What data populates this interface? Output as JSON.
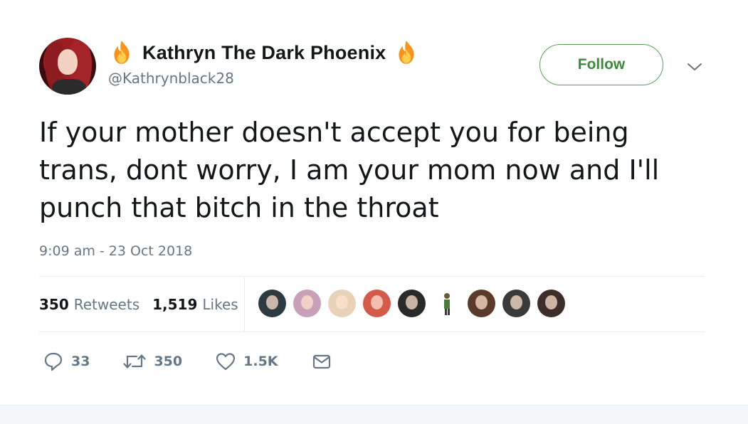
{
  "author": {
    "display_name": "Kathryn The Dark Phoenix",
    "handle": "@Kathrynblack28",
    "avatar_icon": "profile-avatar",
    "name_emoji_icon": "fire-emoji-icon"
  },
  "follow_label": "Follow",
  "tweet": {
    "text": "If your mother doesn't accept you for being\ntrans, dont worry, I am your mom now and I'll\npunch that bitch in the throat",
    "timestamp": "9:09 am - 23 Oct 2018"
  },
  "stats": {
    "retweets_count": "350",
    "retweets_label": "Retweets",
    "likes_count": "1,519",
    "likes_label": "Likes"
  },
  "likers_count_shown": 9,
  "actions": {
    "reply_count": "33",
    "retweet_count": "350",
    "like_count": "1.5K"
  },
  "colors": {
    "follow_green": "#3c8a3c",
    "meta_gray": "#657786",
    "text": "#14171a",
    "flame_orange": "#f7931e",
    "flame_yellow": "#ffcc4d"
  }
}
